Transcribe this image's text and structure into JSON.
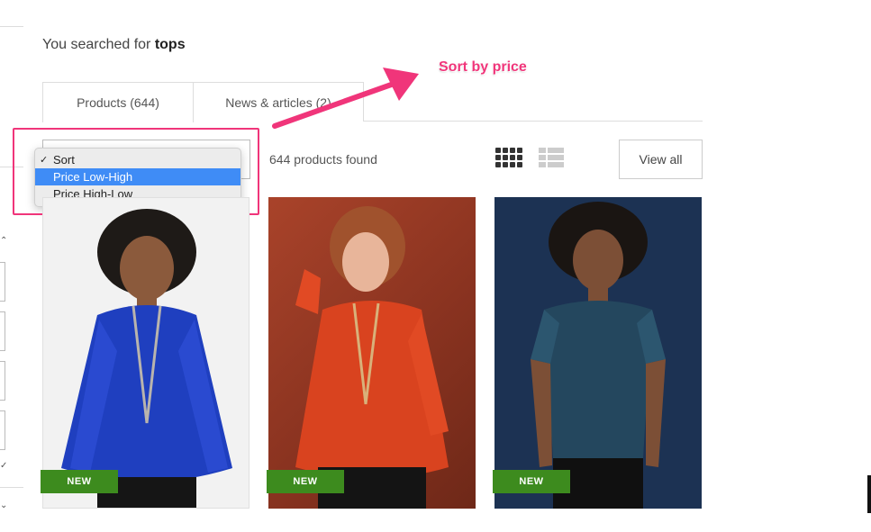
{
  "search": {
    "prefix": "You searched for ",
    "query": "tops"
  },
  "tabs": [
    {
      "label": "Products (644)",
      "active": true
    },
    {
      "label": "News & articles (2)",
      "active": false
    }
  ],
  "sort_dropdown": {
    "check_mark": "✓",
    "options": [
      "Sort",
      "Price Low-High",
      "Price High-Low"
    ],
    "selected": "Sort",
    "highlighted": "Price Low-High"
  },
  "results": {
    "count_text": "644 products found"
  },
  "view": {
    "grid_icon": "grid-view-icon",
    "list_icon": "list-view-icon",
    "view_all_label": "View all"
  },
  "products": [
    {
      "badge": "NEW",
      "description": "blue-pleated-top",
      "color": "#1f3fbf"
    },
    {
      "badge": "NEW",
      "description": "orange-pleated-top",
      "color": "#d9431f"
    },
    {
      "badge": "NEW",
      "description": "navy-lace-top",
      "color": "#24475e"
    }
  ],
  "annotation": {
    "text": "Sort by price",
    "color": "#f0357a"
  },
  "colors": {
    "badge_green": "#3d8b1e",
    "highlight_blue": "#3f8cf6"
  }
}
